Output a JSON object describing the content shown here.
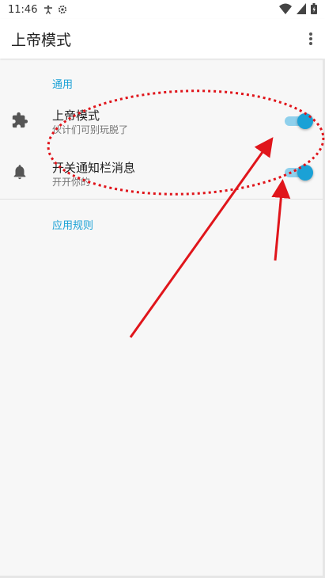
{
  "status_bar": {
    "time": "11:46",
    "icons": [
      "accessibility-icon",
      "settings-icon",
      "wifi-icon",
      "signal-icon",
      "battery-icon"
    ]
  },
  "app_bar": {
    "title": "上帝模式",
    "menu_icon": "more-vert-icon"
  },
  "sections": {
    "general": {
      "label": "通用"
    },
    "rules": {
      "label": "应用规则"
    }
  },
  "preferences": [
    {
      "icon": "extension-icon",
      "title": "上帝模式",
      "summary": "伙计们可别玩脱了",
      "switch_on": true
    },
    {
      "icon": "bell-icon",
      "title": "开关通知栏消息",
      "summary": "开开你的",
      "switch_on": true
    }
  ],
  "colors": {
    "accent": "#1ba1d6",
    "annotation": "#e0151b"
  }
}
